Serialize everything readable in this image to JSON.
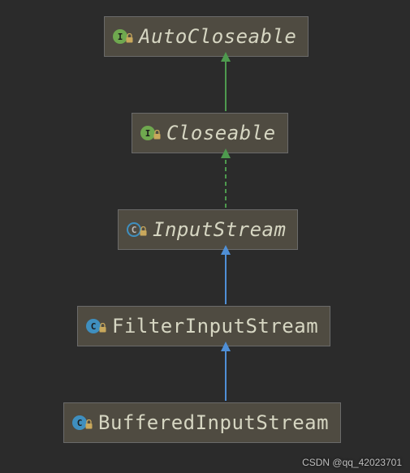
{
  "nodes": {
    "autocloseable": {
      "label": "AutoCloseable",
      "kind": "interface",
      "badge": "I"
    },
    "closeable": {
      "label": "Closeable",
      "kind": "interface",
      "badge": "I"
    },
    "inputstream": {
      "label": "InputStream",
      "kind": "abstract",
      "badge": "C"
    },
    "filterinput": {
      "label": "FilterInputStream",
      "kind": "class",
      "badge": "C"
    },
    "bufferedinput": {
      "label": "BufferedInputStream",
      "kind": "class",
      "badge": "C"
    }
  },
  "colors": {
    "interfaceBadge": "#6fa84f",
    "classBadge": "#3f8fbf",
    "lock": "#c9a85c",
    "implementsArrow": "#4e9a4e",
    "extendsArrow": "#4f8fd6"
  },
  "watermark": "CSDN @qq_42023701"
}
